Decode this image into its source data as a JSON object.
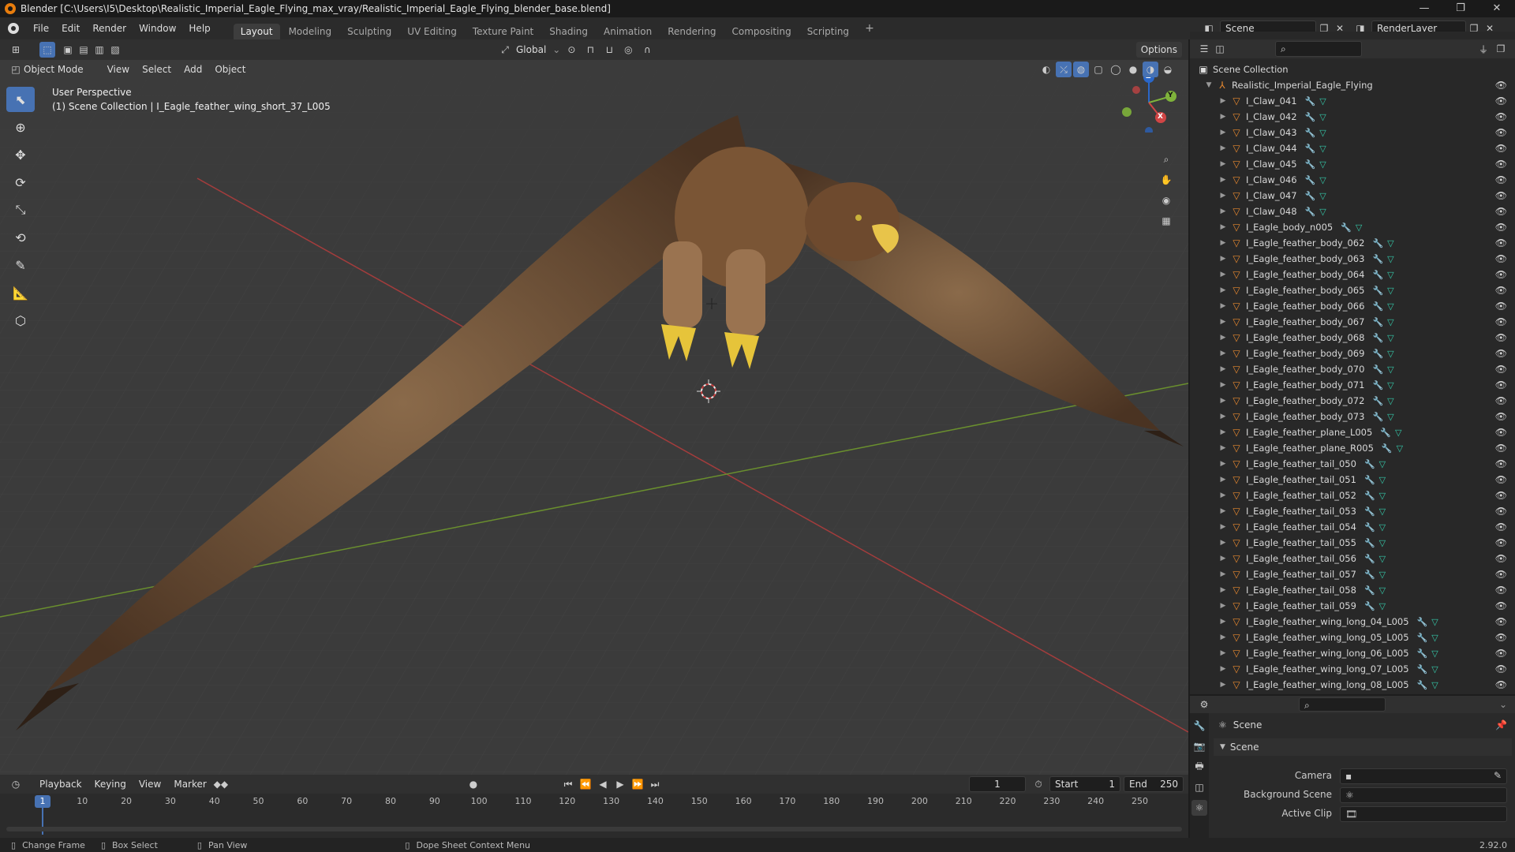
{
  "window": {
    "title": "Blender [C:\\Users\\I5\\Desktop\\Realistic_Imperial_Eagle_Flying_max_vray/Realistic_Imperial_Eagle_Flying_blender_base.blend]",
    "minimize": "—",
    "maximize": "❐",
    "close": "✕"
  },
  "menu": [
    "File",
    "Edit",
    "Render",
    "Window",
    "Help"
  ],
  "workspaces": [
    {
      "label": "Layout",
      "active": true
    },
    {
      "label": "Modeling"
    },
    {
      "label": "Sculpting"
    },
    {
      "label": "UV Editing"
    },
    {
      "label": "Texture Paint"
    },
    {
      "label": "Shading"
    },
    {
      "label": "Animation"
    },
    {
      "label": "Rendering"
    },
    {
      "label": "Compositing"
    },
    {
      "label": "Scripting"
    }
  ],
  "add_workspace": "+",
  "scene_field": "Scene",
  "renderlayer_field": "RenderLayer",
  "viewport_header": {
    "transform": "Global",
    "options": "Options",
    "mode": "Object Mode",
    "view": "View",
    "select": "Select",
    "add": "Add",
    "object": "Object"
  },
  "viewport": {
    "perspective": "User Perspective",
    "collection_info": "(1) Scene Collection | I_Eagle_feather_wing_short_37_L005",
    "gizmo": {
      "x": "X",
      "y": "Y",
      "z": "Z"
    }
  },
  "outliner": {
    "root": "Scene Collection",
    "collection": "Realistic_Imperial_Eagle_Flying",
    "items": [
      "I_Claw_041",
      "I_Claw_042",
      "I_Claw_043",
      "I_Claw_044",
      "I_Claw_045",
      "I_Claw_046",
      "I_Claw_047",
      "I_Claw_048",
      "I_Eagle_body_n005",
      "I_Eagle_feather_body_062",
      "I_Eagle_feather_body_063",
      "I_Eagle_feather_body_064",
      "I_Eagle_feather_body_065",
      "I_Eagle_feather_body_066",
      "I_Eagle_feather_body_067",
      "I_Eagle_feather_body_068",
      "I_Eagle_feather_body_069",
      "I_Eagle_feather_body_070",
      "I_Eagle_feather_body_071",
      "I_Eagle_feather_body_072",
      "I_Eagle_feather_body_073",
      "I_Eagle_feather_plane_L005",
      "I_Eagle_feather_plane_R005",
      "I_Eagle_feather_tail_050",
      "I_Eagle_feather_tail_051",
      "I_Eagle_feather_tail_052",
      "I_Eagle_feather_tail_053",
      "I_Eagle_feather_tail_054",
      "I_Eagle_feather_tail_055",
      "I_Eagle_feather_tail_056",
      "I_Eagle_feather_tail_057",
      "I_Eagle_feather_tail_058",
      "I_Eagle_feather_tail_059",
      "I_Eagle_feather_wing_long_04_L005",
      "I_Eagle_feather_wing_long_05_L005",
      "I_Eagle_feather_wing_long_06_L005",
      "I_Eagle_feather_wing_long_07_L005",
      "I_Eagle_feather_wing_long_08_L005"
    ]
  },
  "properties": {
    "header": "Scene",
    "section": "Scene",
    "camera_label": "Camera",
    "background_label": "Background Scene",
    "clip_label": "Active Clip"
  },
  "timeline": {
    "playback": "Playback",
    "keying": "Keying",
    "view": "View",
    "marker": "Marker",
    "current_frame": "1",
    "start_label": "Start",
    "start_value": "1",
    "end_label": "End",
    "end_value": "250",
    "ruler": [
      "10",
      "20",
      "30",
      "40",
      "50",
      "60",
      "70",
      "80",
      "90",
      "100",
      "110",
      "120",
      "130",
      "140",
      "150",
      "160",
      "170",
      "180",
      "190",
      "200",
      "210",
      "220",
      "230",
      "240",
      "250"
    ],
    "playhead": "1"
  },
  "status": {
    "change_frame": "Change Frame",
    "box_select": "Box Select",
    "pan_view": "Pan View",
    "context_menu": "Dope Sheet Context Menu",
    "version": "2.92.0"
  },
  "colors": {
    "accent": "#4772b3",
    "orange": "#e8892f",
    "x_axis": "#c23b3b",
    "y_axis": "#6f9a2b"
  }
}
